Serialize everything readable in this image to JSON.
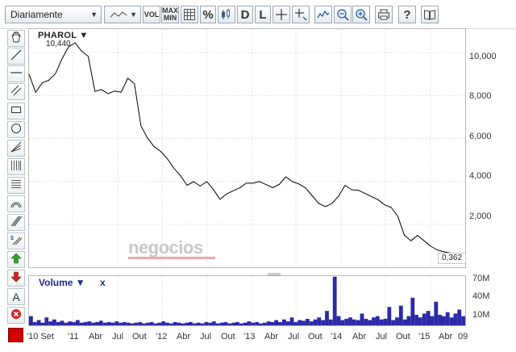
{
  "toolbar": {
    "period_select": "Diariamente",
    "vol_label": "VOL",
    "maxmin_top": "MAX",
    "maxmin_bottom": "MIN",
    "percent_label": "%",
    "d_label": "D",
    "l_label": "L",
    "help_label": "?"
  },
  "palette": {
    "text_tool_label": "A",
    "color": "#d40000"
  },
  "chart": {
    "symbol": "PHAROL ▼",
    "max_label": "10,440",
    "last_value": "0,362",
    "watermark": "negocios",
    "volume_label": "Volume ▼",
    "volume_close": "x",
    "line_color": "#000000",
    "volume_color": "#2a2aa8"
  },
  "chart_data": {
    "type": "line",
    "series": [
      {
        "values": [
          9.0,
          8.1,
          8.5,
          8.6,
          8.9,
          9.6,
          10.2,
          10.44,
          10.1,
          9.9,
          8.3,
          8.4,
          8.2,
          8.3,
          8.2,
          8.8,
          8.5,
          6.5,
          5.9,
          5.5,
          5.3,
          5.0,
          4.6,
          4.3,
          3.9,
          4.1,
          3.9,
          4.1,
          3.7,
          3.2,
          3.4,
          3.5,
          3.6,
          3.8,
          3.8,
          3.9,
          3.8,
          3.7,
          3.9,
          4.3,
          4.1,
          4.0,
          3.8,
          3.4,
          3.0,
          2.8,
          2.9,
          3.2,
          3.7,
          3.5,
          3.5,
          3.4,
          3.3,
          3.2,
          3.0,
          2.9,
          2.5,
          1.6,
          1.3,
          1.5,
          1.2,
          0.9,
          0.7,
          0.6,
          0.55,
          0.5,
          0.362
        ]
      }
    ],
    "ylim": [
      0,
      11.1
    ],
    "yticks": [
      "10,000",
      "8,000",
      "6,000",
      "4,000",
      "2,000"
    ],
    "xticks": [
      "'10 Set",
      "'11",
      "Abr",
      "Jul",
      "Out",
      "'12",
      "Abr",
      "Jul",
      "Out",
      "'13",
      "Abr",
      "Jul",
      "Out",
      "'14",
      "Abr",
      "Jul",
      "Out",
      "'15",
      "Abr",
      "09"
    ],
    "volume": {
      "yticks": [
        "70M",
        "40M",
        "10M"
      ],
      "ylim": [
        0,
        75
      ],
      "values": [
        14,
        5,
        8,
        4,
        12,
        6,
        9,
        5,
        7,
        4,
        6,
        5,
        8,
        4,
        5,
        6,
        4,
        5,
        7,
        4,
        5,
        4,
        6,
        4,
        5,
        4,
        3,
        4,
        5,
        3,
        4,
        5,
        3,
        4,
        6,
        4,
        3,
        5,
        4,
        3,
        4,
        5,
        3,
        4,
        3,
        5,
        4,
        6,
        3,
        4,
        5,
        3,
        4,
        5,
        3,
        4,
        6,
        4,
        5,
        3,
        4,
        6,
        5,
        8,
        5,
        9,
        6,
        12,
        5,
        8,
        7,
        10,
        6,
        9,
        12,
        8,
        22,
        9,
        74,
        14,
        8,
        10,
        12,
        9,
        8,
        18,
        10,
        8,
        12,
        14,
        9,
        10,
        28,
        8,
        12,
        30,
        9,
        14,
        42,
        16,
        12,
        18,
        22,
        14,
        36,
        16,
        14,
        20,
        12,
        18,
        24,
        14
      ]
    },
    "grid": true
  }
}
